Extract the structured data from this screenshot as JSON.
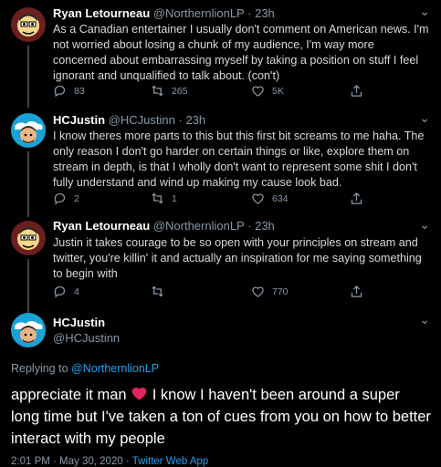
{
  "tweets": [
    {
      "name": "Ryan Letourneau",
      "handle": "@NorthernlionLP",
      "time": "23h",
      "text": "As a Canadian entertainer I usually don't comment on American news. I'm not worried about losing a chunk of my audience, I'm way more concerned about embarrassing myself by taking a position on stuff I feel ignorant and unqualified to talk about. (con't)",
      "replies": "83",
      "retweets": "265",
      "likes": "5K"
    },
    {
      "name": "HCJustin",
      "handle": "@HCJustinn",
      "time": "23h",
      "text": "I know theres more parts to this but this first bit screams to me haha.  The only reason I don't go harder on certain things or like, explore them on stream in depth, is that I wholly don't want to represent some shit I don't fully understand and wind up making my cause look bad.",
      "replies": "2",
      "retweets": "1",
      "likes": "634"
    },
    {
      "name": "Ryan Letourneau",
      "handle": "@NorthernlionLP",
      "time": "23h",
      "text": "Justin it takes courage to be so open with your principles on stream and twitter, you're killin' it and actually an inspiration for me saying something to begin with",
      "replies": "4",
      "retweets": "",
      "likes": "770"
    }
  ],
  "main_tweet": {
    "name": "HCJustin",
    "handle": "@HCJustinn",
    "replying_label": "Replying to",
    "replying_to": "@NorthernlionLP",
    "text_before": "appreciate it man",
    "text_after": "I know I haven't been around a super long time but I've taken a ton of cues from you on how to better interact with my people",
    "timestamp": "2:01 PM · May 30, 2020 · ",
    "source": "Twitter Web App"
  },
  "separator": "·",
  "colors": {
    "accent": "#1da1f2",
    "heart": "#e0245e",
    "muted": "#8899a6"
  }
}
